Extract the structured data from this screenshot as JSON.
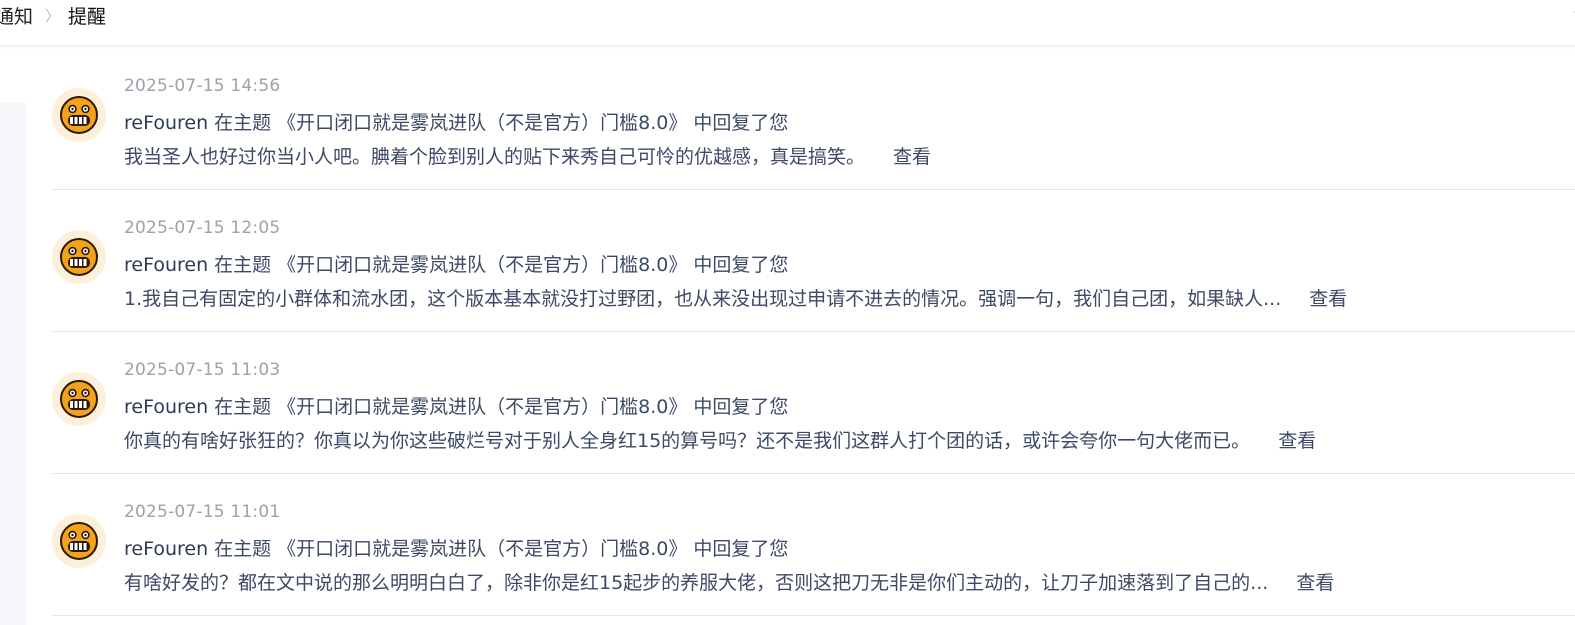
{
  "breadcrumb": {
    "parent": "通知",
    "separator": "〉",
    "current": "提醒"
  },
  "collapse_icon": "《",
  "colors": {
    "avatar_bg": "#fdefd9",
    "avatar_face": "#f4a21b",
    "text": "#3d4a66",
    "time": "#9ca1ab"
  },
  "notifications": [
    {
      "time": "2025-07-15 14:56",
      "user": "reFouren",
      "prefix": "在主题",
      "topic": "《开口闭口就是雾岚进队（不是官方）门槛8.0》",
      "suffix": "中回复了您",
      "excerpt": "我当圣人也好过你当小人吧。腆着个脸到别人的贴下来秀自己可怜的优越感，真是搞笑。",
      "action": "查看"
    },
    {
      "time": "2025-07-15 12:05",
      "user": "reFouren",
      "prefix": "在主题",
      "topic": "《开口闭口就是雾岚进队（不是官方）门槛8.0》",
      "suffix": "中回复了您",
      "excerpt": "1.我自己有固定的小群体和流水团，这个版本基本就没打过野团，也从来没出现过申请不进去的情况。强调一句，我们自己团，如果缺人...",
      "action": "查看"
    },
    {
      "time": "2025-07-15 11:03",
      "user": "reFouren",
      "prefix": "在主题",
      "topic": "《开口闭口就是雾岚进队（不是官方）门槛8.0》",
      "suffix": "中回复了您",
      "excerpt": "你真的有啥好张狂的？你真以为你这些破烂号对于别人全身红15的算号吗？还不是我们这群人打个团的话，或许会夸你一句大佬而已。",
      "action": "查看"
    },
    {
      "time": "2025-07-15 11:01",
      "user": "reFouren",
      "prefix": "在主题",
      "topic": "《开口闭口就是雾岚进队（不是官方）门槛8.0》",
      "suffix": "中回复了您",
      "excerpt": "有啥好发的？都在文中说的那么明明白白了，除非你是红15起步的养服大佬，否则这把刀无非是你们主动的，让刀子加速落到了自己的...",
      "action": "查看"
    }
  ]
}
